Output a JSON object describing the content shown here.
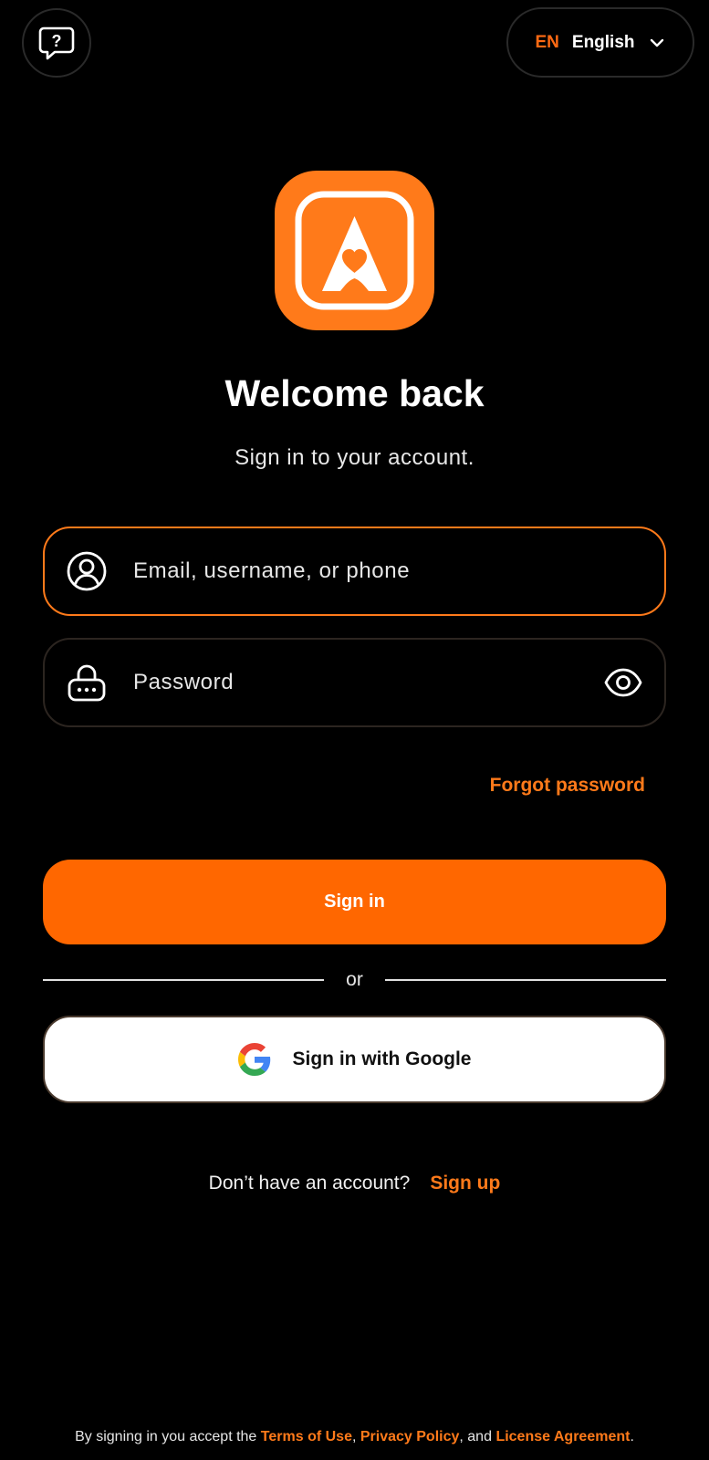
{
  "header": {
    "help_icon": "help-chat-icon",
    "language": {
      "code": "EN",
      "name": "English",
      "icon": "chevron-down-icon"
    }
  },
  "logo": {
    "icon": "app-logo-a-heart",
    "color": "#ff7a1a"
  },
  "title": "Welcome back",
  "subtitle": "Sign in to your account.",
  "form": {
    "email": {
      "placeholder": "Email, username, or phone",
      "value": "",
      "icon": "user-circle-icon"
    },
    "password": {
      "placeholder": "Password",
      "value": "",
      "icon": "lock-icon",
      "toggle_icon": "eye-icon"
    },
    "forgot_label": "Forgot password",
    "submit_label": "Sign in"
  },
  "divider_label": "or",
  "google": {
    "label": "Sign in with Google",
    "icon": "google-icon"
  },
  "signup": {
    "prompt": "Don’t have an account?",
    "link": "Sign up"
  },
  "legal": {
    "prefix": "By signing in you accept the",
    "terms": "Terms of Use",
    "sep1": ",",
    "privacy": "Privacy Policy",
    "sep2": ", and",
    "license": "License Agreement",
    "suffix": "."
  },
  "colors": {
    "accent": "#ff6700",
    "background": "#000000",
    "border": "#2a2a2a"
  }
}
